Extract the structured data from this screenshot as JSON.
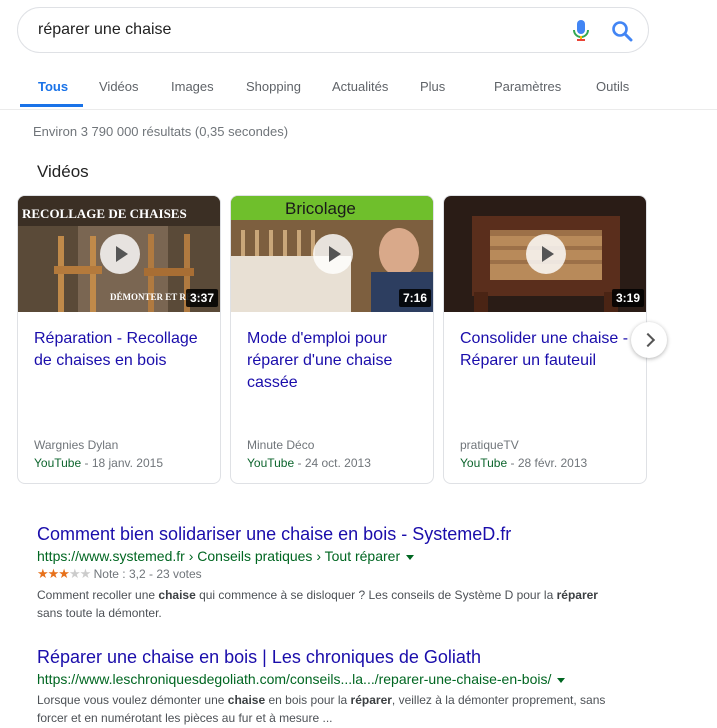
{
  "search": {
    "query": "réparer une chaise"
  },
  "tabs": [
    {
      "label": "Tous"
    },
    {
      "label": "Vidéos"
    },
    {
      "label": "Images"
    },
    {
      "label": "Shopping"
    },
    {
      "label": "Actualités"
    },
    {
      "label": "Plus"
    },
    {
      "label": "Paramètres"
    },
    {
      "label": "Outils"
    }
  ],
  "stats": "Environ 3 790 000 résultats (0,35 secondes)",
  "videos": {
    "heading": "Vidéos",
    "cards": [
      {
        "thumb_text": "RECOLLAGE DE CHAISES",
        "thumb_subtext": "DÉMONTER ET REMO",
        "duration": "3:37",
        "title": "Réparation - Recollage de chaises en bois",
        "channel": "Wargnies Dylan",
        "source": "YouTube",
        "date": " - 18 janv. 2015"
      },
      {
        "thumb_text": "Bricolage",
        "duration": "7:16",
        "title": "Mode d'emploi pour réparer d'une chaise cassée",
        "channel": "Minute Déco",
        "source": "YouTube",
        "date": " - 24 oct. 2013"
      },
      {
        "duration": "3:19",
        "title": "Consolider une chaise - Réparer un fauteuil",
        "channel": "pratiqueTV",
        "source": "YouTube",
        "date": " - 28 févr. 2013"
      }
    ]
  },
  "results": [
    {
      "title": "Comment bien solidariser une chaise en bois - SystemeD.fr",
      "url": "https://www.systemed.fr › Conseils pratiques › Tout réparer",
      "rating": 3.2,
      "rating_text": "Note : 3,2 - 23 votes",
      "snippet_parts": [
        "Comment recoller une ",
        "chaise",
        " qui commence à se disloquer ? Les conseils de Système D pour la ",
        "réparer",
        " sans toute la démonter."
      ]
    },
    {
      "title": "Réparer une chaise en bois | Les chroniques de Goliath",
      "url": "https://www.leschroniquesdegoliath.com/conseils...la.../reparer-une-chaise-en-bois/",
      "snippet_parts": [
        "Lorsque vous voulez démonter une ",
        "chaise",
        " en bois pour la ",
        "réparer",
        ", veillez à la démonter proprement, sans forcer et en numérotant les pièces au fur et à mesure ..."
      ]
    }
  ],
  "colors": {
    "link": "#1a0dab",
    "url_green": "#006621",
    "tab_active": "#1a73e8",
    "star": "#e7711b"
  }
}
